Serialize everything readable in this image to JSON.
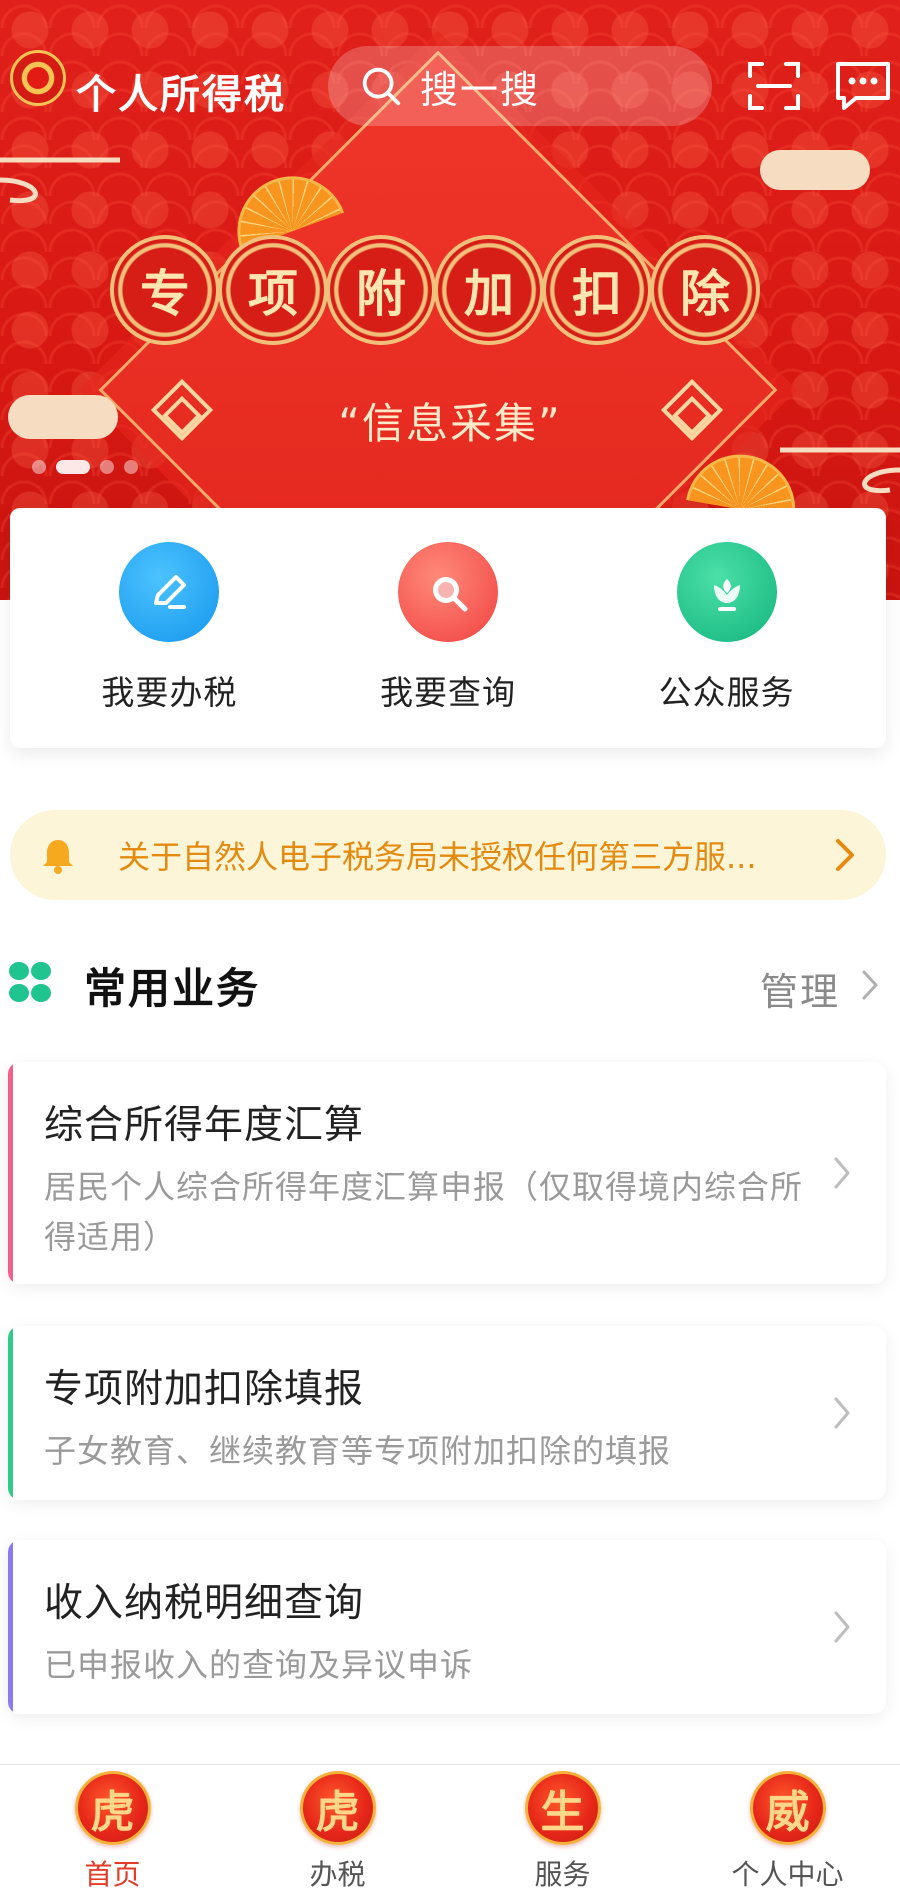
{
  "header": {
    "app_title": "个人所得税",
    "search_placeholder": "搜一搜",
    "icons": [
      "scan-icon",
      "message-icon"
    ]
  },
  "banner": {
    "coin_chars": [
      "专",
      "项",
      "附",
      "加",
      "扣",
      "除"
    ],
    "subtitle": "“信息采集”",
    "slide_count": 4,
    "active_slide": 1
  },
  "quick_actions": [
    {
      "label": "我要办税",
      "icon": "pencil-icon",
      "color": "#1da7f0"
    },
    {
      "label": "我要查询",
      "icon": "search-icon",
      "color": "#ff5a5a"
    },
    {
      "label": "公众服务",
      "icon": "flower-icon",
      "color": "#1fc48f"
    }
  ],
  "notice": {
    "text": "关于自然人电子税务局未授权任何第三方服..."
  },
  "common_services": {
    "title": "常用业务",
    "manage_label": "管理",
    "items": [
      {
        "title": "综合所得年度汇算",
        "desc": "居民个人综合所得年度汇算申报（仅取得境内综合所得适用）",
        "accent": "#f0608a"
      },
      {
        "title": "专项附加扣除填报",
        "desc": "子女教育、继续教育等专项附加扣除的填报",
        "accent": "#33c98a"
      },
      {
        "title": "收入纳税明细查询",
        "desc": "已申报收入的查询及异议申诉",
        "accent": "#8a7cf0"
      }
    ]
  },
  "tabbar": {
    "active": 0,
    "tabs": [
      {
        "badge": "虎",
        "label": "首页"
      },
      {
        "badge": "虎",
        "label": "办税"
      },
      {
        "badge": "生",
        "label": "服务"
      },
      {
        "badge": "威",
        "label": "个人中心"
      }
    ]
  },
  "colors": {
    "banner_red": "#d81812",
    "notice_bg": "#fdf5d8",
    "notice_text": "#e38a10",
    "active_tab": "#e23b2a"
  }
}
